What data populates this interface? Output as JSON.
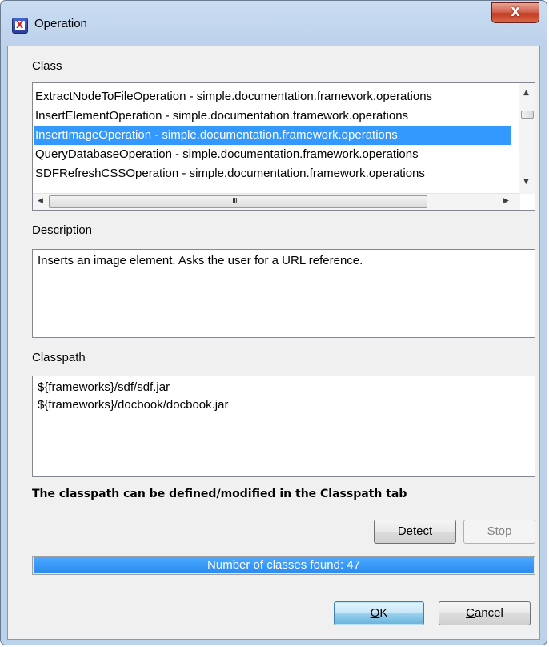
{
  "window": {
    "title": "Operation",
    "close_label": "X"
  },
  "class_section": {
    "label": "Class",
    "items": [
      "ExtractNodeToFileOperation - simple.documentation.framework.operations",
      "InsertElementOperation - simple.documentation.framework.operations",
      "InsertImageOperation - simple.documentation.framework.operations",
      "QueryDatabaseOperation - simple.documentation.framework.operations",
      "SDFRefreshCSSOperation - simple.documentation.framework.operations"
    ],
    "selected_index": 2,
    "scroll_up_glyph": "▲",
    "scroll_down_glyph": "▼",
    "scroll_left_glyph": "◀",
    "scroll_right_glyph": "▶",
    "grip_glyph": "III"
  },
  "description": {
    "label": "Description",
    "text": "Inserts an image element. Asks the user for a URL reference."
  },
  "classpath": {
    "label": "Classpath",
    "entries": [
      "${frameworks}/sdf/sdf.jar",
      "${frameworks}/docbook/docbook.jar"
    ],
    "note": "The classpath can be defined/modified in the Classpath tab"
  },
  "buttons": {
    "detect_mnemonic": "D",
    "detect_rest": "etect",
    "stop_mnemonic": "S",
    "stop_rest": "top",
    "ok_mnemonic": "O",
    "ok_rest": "K",
    "cancel_mnemonic": "C",
    "cancel_rest": "ancel"
  },
  "progress": {
    "text": "Number of classes found: 47",
    "fraction": 1.0
  },
  "colors": {
    "selection": "#3399ff",
    "progress_fill": "#2b8bef"
  }
}
